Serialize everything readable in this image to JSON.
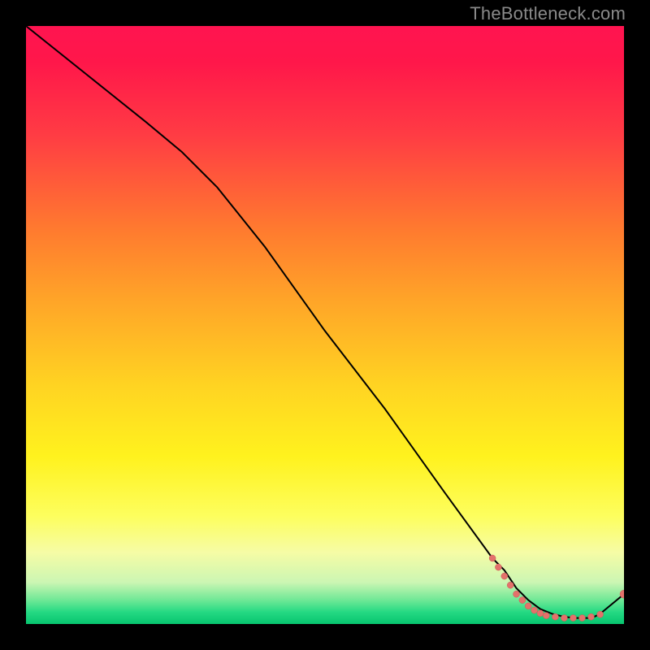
{
  "watermark": "TheBottleneck.com",
  "colors": {
    "marker_fill": "#e4716b",
    "marker_stroke": "#c85b55",
    "curve": "#000000"
  },
  "chart_data": {
    "type": "line",
    "title": "",
    "xlabel": "",
    "ylabel": "",
    "xlim": [
      0,
      100
    ],
    "ylim": [
      0,
      100
    ],
    "series": [
      {
        "name": "bottleneck-curve",
        "x": [
          0,
          10,
          20,
          26,
          32,
          40,
          50,
          60,
          70,
          78,
          80,
          82,
          84,
          86,
          88,
          90,
          92,
          94,
          95,
          96,
          100
        ],
        "y": [
          100,
          92,
          84,
          79,
          73,
          63,
          49,
          36,
          22,
          11,
          9,
          6,
          4,
          2.5,
          1.7,
          1.2,
          1.0,
          1.0,
          1.2,
          1.7,
          5
        ]
      }
    ],
    "markers": [
      {
        "x": 78.0,
        "y": 11.0,
        "r": 4
      },
      {
        "x": 79.0,
        "y": 9.5,
        "r": 4
      },
      {
        "x": 80.0,
        "y": 8.0,
        "r": 4
      },
      {
        "x": 81.0,
        "y": 6.5,
        "r": 4
      },
      {
        "x": 82.0,
        "y": 5.0,
        "r": 4
      },
      {
        "x": 83.0,
        "y": 4.0,
        "r": 4
      },
      {
        "x": 84.0,
        "y": 3.0,
        "r": 4
      },
      {
        "x": 85.0,
        "y": 2.3,
        "r": 4
      },
      {
        "x": 86.0,
        "y": 1.8,
        "r": 4
      },
      {
        "x": 87.0,
        "y": 1.4,
        "r": 4
      },
      {
        "x": 88.5,
        "y": 1.2,
        "r": 4
      },
      {
        "x": 90.0,
        "y": 1.0,
        "r": 4
      },
      {
        "x": 91.5,
        "y": 1.0,
        "r": 4
      },
      {
        "x": 93.0,
        "y": 1.0,
        "r": 4
      },
      {
        "x": 94.5,
        "y": 1.2,
        "r": 4
      },
      {
        "x": 96.0,
        "y": 1.6,
        "r": 4
      },
      {
        "x": 100.0,
        "y": 5.0,
        "r": 5
      }
    ]
  }
}
